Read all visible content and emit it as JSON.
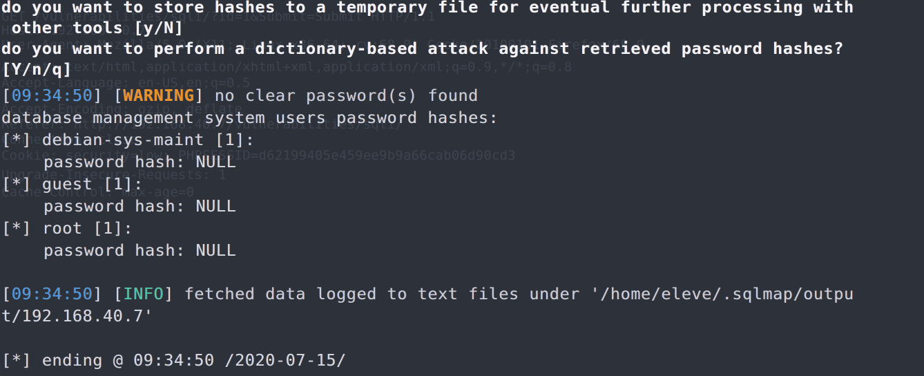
{
  "terminal": {
    "app": "sqlmap",
    "background_color": "#2d313a",
    "foreground_color": "#d4d9e2",
    "colors": {
      "timestamp": "#4d9ae0",
      "warning": "#e8922c",
      "info": "#4fc7a5",
      "ghost": "#3c4450",
      "bold_prompt": "#f2f4f8"
    },
    "prompts": [
      {
        "id": "store-hashes-prompt",
        "text": "do you want to store hashes to a temporary file for eventual further processing with",
        "continuation": " other tools [y/N]",
        "options": "[y/N]"
      },
      {
        "id": "dictionary-attack-prompt",
        "text": "do you want to perform a dictionary-based attack against retrieved password hashes?",
        "continuation": "[Y/n/q]",
        "options": "[Y/n/q]"
      }
    ],
    "log_lines": [
      {
        "id": "warning-no-clear-password",
        "timestamp": "09:34:50",
        "level": "WARNING",
        "message": "no clear password(s) found"
      },
      {
        "id": "info-fetched-data-logged",
        "timestamp": "09:34:50",
        "level": "INFO",
        "message": "fetched data logged to text files under '/home/eleve/.sqlmap/outpu",
        "message_wrap": "t/192.168.40.7'"
      }
    ],
    "hashes_header": "database management system users password hashes:",
    "users": [
      {
        "marker": "[*]",
        "name": "debian-sys-maint",
        "count": "[1]",
        "hash_label": "password hash:",
        "hash_value": "NULL"
      },
      {
        "marker": "[*]",
        "name": "guest",
        "count": "[1]",
        "hash_label": "password hash:",
        "hash_value": "NULL"
      },
      {
        "marker": "[*]",
        "name": "root",
        "count": "[1]",
        "hash_label": "password hash:",
        "hash_value": "NULL"
      }
    ],
    "ending": {
      "marker": "[*]",
      "text": "ending @ 09:34:50 /2020-07-15/",
      "time": "09:34:50",
      "date": "/2020-07-15/"
    },
    "ghost_headers": [
      "GET /vulnerabilities/sqli/?id=1&Submit=Submit HTTP/1.1",
      "Host: 192.168.40.7",
      "User-Agent: Mozilla/5.0 (X11; Linux x86_64; rv:68.0) Gecko/20100101 Firefox/68.0",
      "Accept: text/html,application/xhtml+xml,application/xml;q=0.9,*/*;q=0.8",
      "Accept-Language: en-US,en;q=0.5",
      "Accept-Encoding: gzip, deflate",
      "Referer: http://192.168.40.7/vulnerabilities/sqli/",
      "Connection: close",
      "Cookie: security=low; PHPSESSID=d62199405e459ee9b9a66cab06d90cd3",
      "Upgrade-Insecure-Requests: 1",
      "Cache-Control: max-age=0"
    ]
  }
}
